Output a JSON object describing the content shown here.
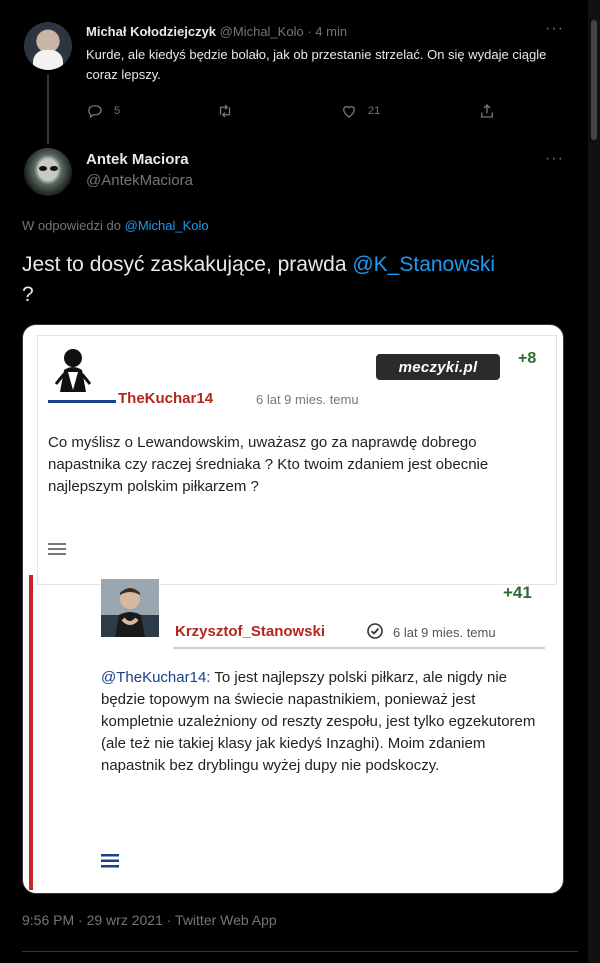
{
  "reply_tweet": {
    "name": "Michał Kołodziejczyk",
    "handle": "@Michal_Kolo",
    "time": "4 min",
    "text": "Kurde, ale kiedyś będzie bolało, jak ob przestanie strzelać. On się wydaje ciągle coraz lepszy.",
    "reply_count": "5",
    "retweet_count": "",
    "like_count": "21"
  },
  "main_tweet": {
    "name": "Antek Maciora",
    "handle": "@AntekMaciora",
    "replying_prefix": "W odpowiedzi do ",
    "replying_to": "@Michal_Kolo",
    "text_before": "Jest to dosyć zaskakujące, prawda ",
    "text_mention": "@K_Stanowski",
    "text_after": " ?",
    "footer": "9:56 PM · 29 wrz 2021 · Twitter Web App"
  },
  "media": {
    "logo_text": "meczyki.pl",
    "comment1": {
      "user": "TheKuchar14",
      "ago": "6 lat 9 mies. temu",
      "score": "+8",
      "text": "Co myślisz o Lewandowskim, uważasz go za naprawdę dobrego napastnika czy raczej średniaka ? Kto twoim zdaniem jest obecnie najlepszym polskim piłkarzem ?"
    },
    "comment2": {
      "user": "Krzysztof_Stanowski",
      "ago": "6 lat 9 mies. temu",
      "score": "+41",
      "mention": "@TheKuchar14:",
      "text": " To jest najlepszy polski piłkarz, ale nigdy nie będzie topowym na świecie napastnikiem, ponieważ jest kompletnie uzależniony od reszty zespołu, jest tylko egzekutorem (ale też nie takiej klasy jak kiedyś Inzaghi). Moim zdaniem napastnik bez dryblingu wyżej dupy nie podskoczy."
    }
  },
  "icons": {
    "reply": "reply-icon",
    "retweet": "retweet-icon",
    "like": "heart-icon",
    "share": "share-icon",
    "more": "more-icon",
    "verified": "verified-icon",
    "menu": "menu-icon"
  },
  "colors": {
    "background": "#000000",
    "link": "#1d9bf0",
    "muted": "#71767b",
    "username_red": "#b3251f",
    "score_green": "#2f6b2f"
  }
}
